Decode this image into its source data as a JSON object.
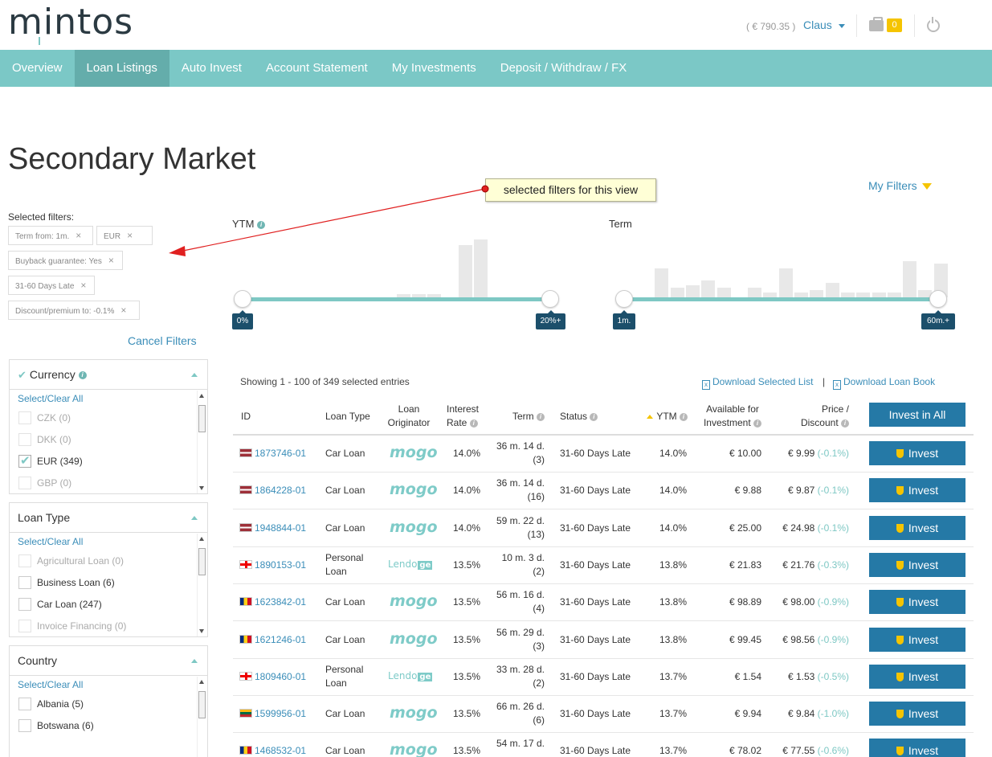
{
  "header": {
    "logo": "mintos",
    "balance": "( € 790.35 )",
    "user": "Claus",
    "cart_count": "0"
  },
  "nav": {
    "items": [
      {
        "label": "Overview"
      },
      {
        "label": "Loan Listings"
      },
      {
        "label": "Auto Invest"
      },
      {
        "label": "Account Statement"
      },
      {
        "label": "My Investments"
      },
      {
        "label": "Deposit / Withdraw / FX"
      }
    ],
    "active": "Loan Listings"
  },
  "page_title": "Secondary Market",
  "callout": "selected filters for this view",
  "my_filters": "My Filters",
  "selected_filters": {
    "label": "Selected filters:",
    "chips": [
      {
        "label": "Term from: 1m."
      },
      {
        "label": "EUR"
      },
      {
        "label": "Buyback guarantee: Yes"
      },
      {
        "label": "31-60 Days Late"
      },
      {
        "label": "Discount/premium to: -0.1%"
      }
    ],
    "cancel": "Cancel Filters"
  },
  "panels": {
    "currency": {
      "title": "Currency",
      "select_all": "Select/Clear All",
      "options": [
        {
          "label": "CZK (0)",
          "checked": false,
          "disabled": true
        },
        {
          "label": "DKK (0)",
          "checked": false,
          "disabled": true
        },
        {
          "label": "EUR (349)",
          "checked": true,
          "disabled": false
        },
        {
          "label": "GBP (0)",
          "checked": false,
          "disabled": true
        }
      ]
    },
    "loan_type": {
      "title": "Loan Type",
      "select_all": "Select/Clear All",
      "options": [
        {
          "label": "Agricultural Loan (0)",
          "checked": false,
          "disabled": true
        },
        {
          "label": "Business Loan (6)",
          "checked": false,
          "disabled": false
        },
        {
          "label": "Car Loan (247)",
          "checked": false,
          "disabled": false
        },
        {
          "label": "Invoice Financing (0)",
          "checked": false,
          "disabled": true
        }
      ]
    },
    "country": {
      "title": "Country",
      "select_all": "Select/Clear All",
      "options": [
        {
          "label": "Albania (5)",
          "checked": false,
          "disabled": false
        },
        {
          "label": "Botswana (6)",
          "checked": false,
          "disabled": false
        }
      ]
    }
  },
  "sliders": {
    "ytm": {
      "label": "YTM",
      "min": "0%",
      "max": "20%+",
      "histogram": [
        0,
        0,
        0,
        0,
        0,
        0,
        0,
        0,
        0,
        0,
        1,
        1,
        1,
        0,
        18,
        20,
        0,
        0,
        0
      ]
    },
    "term": {
      "label": "Term",
      "min": "1m.",
      "max": "60m.+",
      "histogram": [
        0,
        12,
        4,
        5,
        7,
        4,
        0,
        4,
        2,
        12,
        2,
        3,
        6,
        2,
        2,
        2,
        2,
        15,
        3,
        14
      ]
    }
  },
  "table": {
    "showing": "Showing 1 - 100 of 349 selected entries",
    "download_selected": "Download Selected List",
    "download_book": "Download Loan Book",
    "separator": "|",
    "headers": {
      "id": "ID",
      "loan_type": "Loan Type",
      "originator_1": "Loan",
      "originator_2": "Originator",
      "rate_1": "Interest",
      "rate_2": "Rate",
      "term": "Term",
      "status": "Status",
      "ytm": "YTM",
      "avail_1": "Available for",
      "avail_2": "Investment",
      "price_1": "Price /",
      "price_2": "Discount"
    },
    "invest_all": "Invest in All",
    "invest_label": "Invest",
    "rows": [
      {
        "flag": "lv",
        "id": "1873746-01",
        "type_1": "Car Loan",
        "type_2": "",
        "originator": "mogo",
        "rate": "14.0%",
        "term_1": "36 m. 14 d.",
        "term_2": "(3)",
        "status": "31-60 Days Late",
        "ytm": "14.0%",
        "available": "€ 10.00",
        "price": "€ 9.99",
        "discount": "(-0.1%)"
      },
      {
        "flag": "lv",
        "id": "1864228-01",
        "type_1": "Car Loan",
        "type_2": "",
        "originator": "mogo",
        "rate": "14.0%",
        "term_1": "36 m. 14 d.",
        "term_2": "(16)",
        "status": "31-60 Days Late",
        "ytm": "14.0%",
        "available": "€ 9.88",
        "price": "€ 9.87",
        "discount": "(-0.1%)"
      },
      {
        "flag": "lv",
        "id": "1948844-01",
        "type_1": "Car Loan",
        "type_2": "",
        "originator": "mogo",
        "rate": "14.0%",
        "term_1": "59 m. 22 d.",
        "term_2": "(13)",
        "status": "31-60 Days Late",
        "ytm": "14.0%",
        "available": "€ 25.00",
        "price": "€ 24.98",
        "discount": "(-0.1%)"
      },
      {
        "flag": "ge",
        "id": "1890153-01",
        "type_1": "Personal",
        "type_2": "Loan",
        "originator": "lendo",
        "rate": "13.5%",
        "term_1": "10 m. 3 d.",
        "term_2": "(2)",
        "status": "31-60 Days Late",
        "ytm": "13.8%",
        "available": "€ 21.83",
        "price": "€ 21.76",
        "discount": "(-0.3%)"
      },
      {
        "flag": "ro",
        "id": "1623842-01",
        "type_1": "Car Loan",
        "type_2": "",
        "originator": "mogo",
        "rate": "13.5%",
        "term_1": "56 m. 16 d.",
        "term_2": "(4)",
        "status": "31-60 Days Late",
        "ytm": "13.8%",
        "available": "€ 98.89",
        "price": "€ 98.00",
        "discount": "(-0.9%)"
      },
      {
        "flag": "ro",
        "id": "1621246-01",
        "type_1": "Car Loan",
        "type_2": "",
        "originator": "mogo",
        "rate": "13.5%",
        "term_1": "56 m. 29 d.",
        "term_2": "(3)",
        "status": "31-60 Days Late",
        "ytm": "13.8%",
        "available": "€ 99.45",
        "price": "€ 98.56",
        "discount": "(-0.9%)"
      },
      {
        "flag": "ge",
        "id": "1809460-01",
        "type_1": "Personal",
        "type_2": "Loan",
        "originator": "lendo",
        "rate": "13.5%",
        "term_1": "33 m. 28 d.",
        "term_2": "(2)",
        "status": "31-60 Days Late",
        "ytm": "13.7%",
        "available": "€ 1.54",
        "price": "€ 1.53",
        "discount": "(-0.5%)"
      },
      {
        "flag": "lt",
        "id": "1599956-01",
        "type_1": "Car Loan",
        "type_2": "",
        "originator": "mogo",
        "rate": "13.5%",
        "term_1": "66 m. 26 d.",
        "term_2": "(6)",
        "status": "31-60 Days Late",
        "ytm": "13.7%",
        "available": "€ 9.94",
        "price": "€ 9.84",
        "discount": "(-1.0%)"
      },
      {
        "flag": "ro",
        "id": "1468532-01",
        "type_1": "Car Loan",
        "type_2": "",
        "originator": "mogo",
        "rate": "13.5%",
        "term_1": "54 m. 17 d.",
        "term_2": "",
        "status": "31-60 Days Late",
        "ytm": "13.7%",
        "available": "€ 78.02",
        "price": "€ 77.55",
        "discount": "(-0.6%)"
      }
    ]
  }
}
